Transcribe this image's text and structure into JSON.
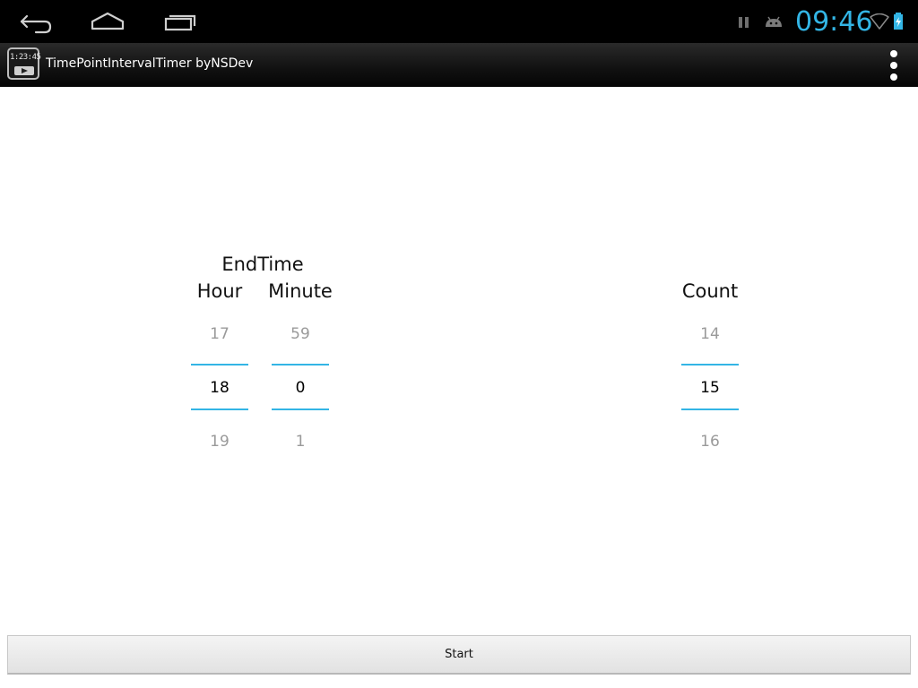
{
  "status_bar": {
    "time": "09:46",
    "icons": [
      "pause-icon",
      "android-debug-icon",
      "wifi-icon",
      "battery-charging-icon"
    ]
  },
  "nav_bar": {
    "buttons": [
      "back-icon",
      "home-icon",
      "recent-apps-icon"
    ]
  },
  "action_bar": {
    "app_icon_digits": "1:23:45",
    "title": "TimePointIntervalTimer byNSDev",
    "overflow_icon": "overflow-menu-icon"
  },
  "end_time": {
    "title": "EndTime",
    "hour": {
      "label": "Hour",
      "prev": "17",
      "value": "18",
      "next": "19"
    },
    "minute": {
      "label": "Minute",
      "prev": "59",
      "value": "0",
      "next": "1"
    }
  },
  "count": {
    "label": "Count",
    "prev": "14",
    "value": "15",
    "next": "16"
  },
  "start_button": {
    "label": "Start"
  },
  "colors": {
    "accent": "#33b5e5",
    "status_bar_bg": "#000000",
    "action_bar_bg": "#111111",
    "content_bg": "#ffffff"
  }
}
